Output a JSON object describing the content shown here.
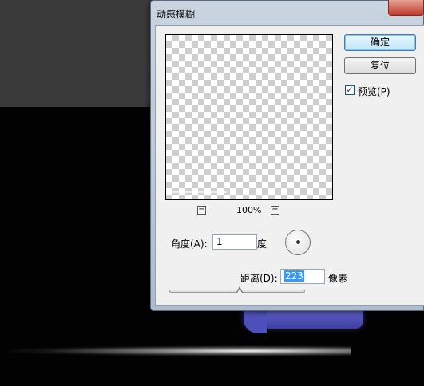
{
  "dialog": {
    "title": "动感模糊",
    "preview_zoom": "100%",
    "zoom_out_symbol": "−",
    "zoom_in_symbol": "+",
    "ok_label": "确定",
    "reset_label": "复位",
    "preview_checkbox": {
      "label": "预览(P)",
      "checked": true,
      "check_symbol": "✓"
    },
    "angle": {
      "label": "角度(A):",
      "value": "1",
      "unit": "度"
    },
    "distance": {
      "label": "距离(D):",
      "value": "223",
      "unit": "像素"
    },
    "distance_slider_level": 0.52
  },
  "colors": {
    "dialog_bg": "#f0f0f0",
    "titlebar": "#c9d4e0",
    "default_button": "#bee6fd",
    "selection": "#3399ff",
    "close_button": "#c0392b",
    "canvas_shape": "#5557c4"
  }
}
